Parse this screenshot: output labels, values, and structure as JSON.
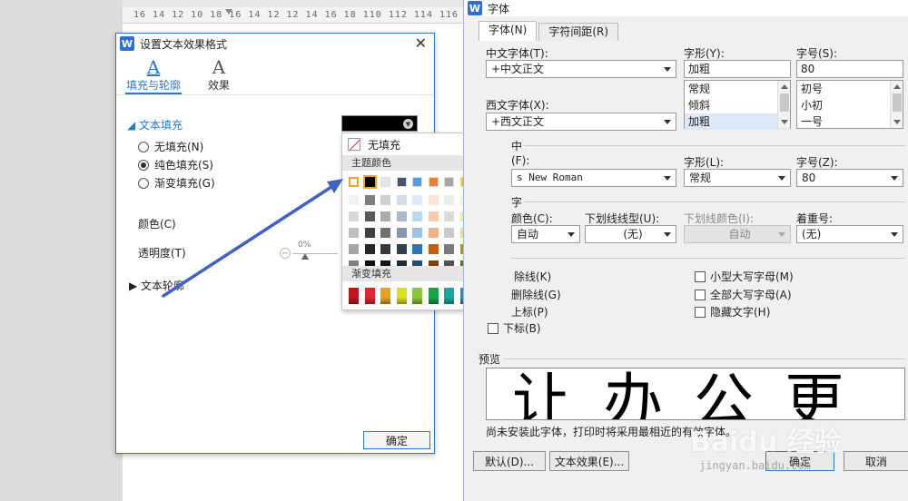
{
  "ruler": {
    "text": "16 14 12 10 18 16 14 12 12 14 16 18 110 112 114 116 118 120"
  },
  "text_effect_panel": {
    "title": "设置文本效果格式",
    "tabs": [
      {
        "label": "填充与轮廓",
        "glyph": "A"
      },
      {
        "label": "效果",
        "glyph": "A"
      }
    ],
    "text_fill_header": "文本填充",
    "fill_options": [
      "无填充(N)",
      "纯色填充(S)",
      "渐变填充(G)"
    ],
    "color_label": "颜色(C)",
    "color_value": "#000000",
    "transparency_label": "透明度(T)",
    "transparency_value": "0%",
    "text_outline_header": "文本轮廓",
    "confirm_label": "确定"
  },
  "color_popup": {
    "no_fill_label": "无填充",
    "theme_colors_header": "主题颜色",
    "gradient_header": "渐变填充",
    "theme_top_row": [
      "#ffffff",
      "#000000",
      "#e7e6e6",
      "#44546a",
      "#5b9bd5",
      "#ed7d31",
      "#a5a5a5",
      "#ffc000",
      "#4472c4",
      "#70ad47"
    ],
    "theme_shades": [
      [
        "#f2f2f2",
        "#7f7f7f",
        "#d0cece",
        "#d6dce4",
        "#deebf6",
        "#fbe5d5",
        "#ededed",
        "#fff2cc",
        "#d9e2f3",
        "#e2efd9"
      ],
      [
        "#d8d8d8",
        "#595959",
        "#aeaaaa",
        "#adb9ca",
        "#bdd7ee",
        "#f7cbac",
        "#dbdbdb",
        "#fee599",
        "#b4c6e7",
        "#c5e0b3"
      ],
      [
        "#bfbfbf",
        "#3f3f3f",
        "#757070",
        "#8496b0",
        "#9cc3e5",
        "#f4b183",
        "#c9c9c9",
        "#ffd965",
        "#8eaadb",
        "#a8d08d"
      ],
      [
        "#a5a5a5",
        "#262626",
        "#3a3838",
        "#323f4f",
        "#2e75b5",
        "#c55a11",
        "#7b7b7b",
        "#bf9000",
        "#2f5496",
        "#538135"
      ],
      [
        "#7f7f7f",
        "#0c0c0c",
        "#171616",
        "#222a35",
        "#1e4e79",
        "#833c0b",
        "#525252",
        "#7f6000",
        "#1f3864",
        "#375623"
      ]
    ],
    "gradient_colors": [
      "#c0151c",
      "#e2262b",
      "#e8a020",
      "#dde01c",
      "#8cc63e",
      "#1aa34a",
      "#17a8a0",
      "#1e8fd6",
      "#1d3f9c",
      "#7a2c9e"
    ]
  },
  "font_dialog": {
    "title": "字体",
    "tabs": [
      "字体(N)",
      "字符间距(R)"
    ],
    "cn_font_label": "中文字体(T):",
    "cn_font_value": "+中文正文",
    "style_label": "字形(Y):",
    "style_value": "加粗",
    "style_options": [
      "常规",
      "倾斜",
      "加粗"
    ],
    "size_label": "字号(S):",
    "size_value": "80",
    "size_options": [
      "初号",
      "小初",
      "一号"
    ],
    "west_font_label": "西文字体(X):",
    "west_font_value": "+西文正文",
    "complex_section": "中",
    "complex_font_label": "(F):",
    "complex_font_value": "s New Roman",
    "complex_style_label": "字形(L):",
    "complex_style_value": "常规",
    "complex_size_label": "字号(Z):",
    "complex_size_value": "80",
    "all_text_section": "字",
    "font_color_label": "颜色(C):",
    "font_color_value": "自动",
    "underline_type_label": "下划线线型(U):",
    "underline_type_value": "(无)",
    "underline_color_label": "下划线颜色(I):",
    "underline_color_value": "自动",
    "emphasis_label": "着重号:",
    "emphasis_value": "(无)",
    "effects_left": [
      "除线(K)",
      "删除线(G)",
      "上标(P)",
      "下标(B)"
    ],
    "effects_right": [
      "小型大写字母(M)",
      "全部大写字母(A)",
      "隐藏文字(H)"
    ],
    "preview_label": "预览",
    "preview_text": "让办公更",
    "preview_note": "尚未安装此字体，打印时将采用最相近的有效字体。",
    "btn_default": "默认(D)...",
    "btn_text_effect": "文本效果(E)...",
    "btn_ok": "确定",
    "btn_cancel": "取消"
  },
  "watermark": {
    "text": "Baidu 经验",
    "sub": "jingyan.baidu.com"
  },
  "colors": {
    "accent": "#2b78c5",
    "arrow": "#3f62c9"
  }
}
